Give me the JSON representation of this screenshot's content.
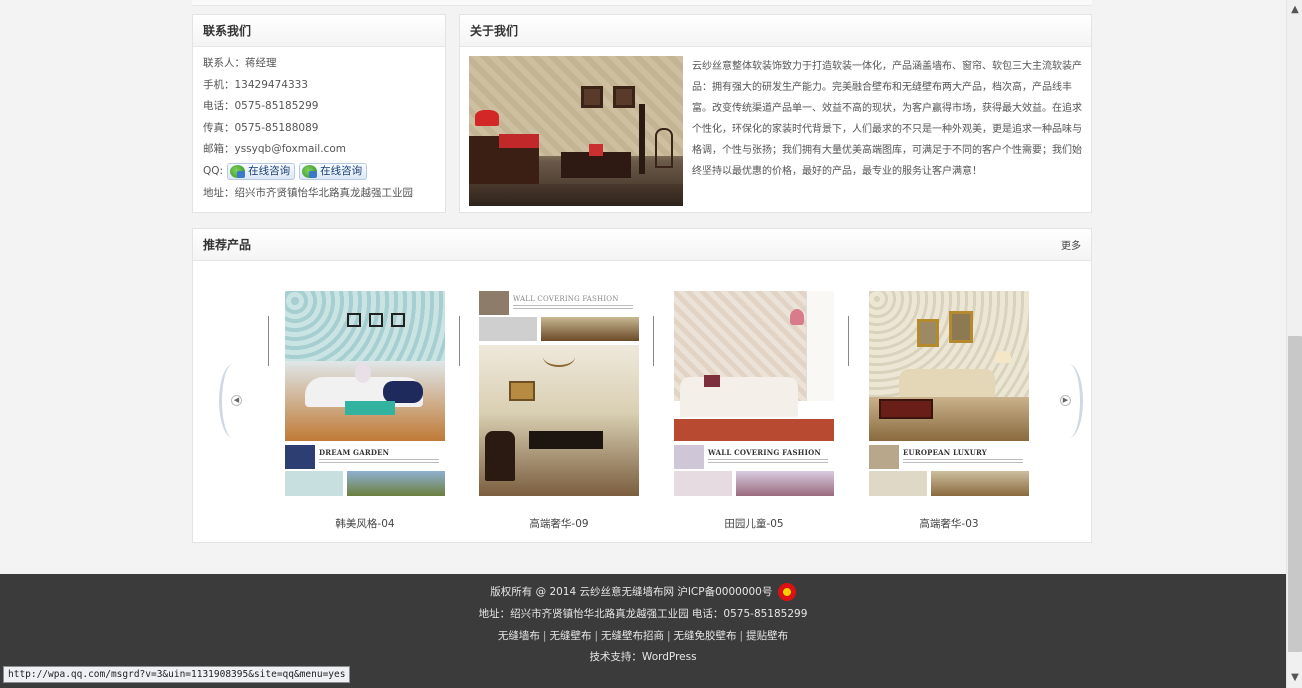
{
  "contact": {
    "title": "联系我们",
    "contact_person": "联系人：蒋经理",
    "mobile": "手机：13429474333",
    "phone": "电话：0575-85185299",
    "fax": "传真：0575-85188089",
    "email": "邮箱：yssyqb@foxmail.com",
    "qq_label": "QQ:",
    "qq_buttons": [
      "在线咨询",
      "在线咨询"
    ],
    "address": "地址：绍兴市齐贤镇怡华北路真龙越强工业园"
  },
  "about": {
    "title": "关于我们",
    "text": "云纱丝意整体软装饰致力于打造软装一体化，产品涵盖墙布、窗帘、软包三大主流软装产品：拥有强大的研发生产能力。完美融合壁布和无缝壁布两大产品，档次高，产品线丰富。改变传统渠道产品单一、效益不高的现状，为客户赢得市场，获得最大效益。在追求个性化，环保化的家装时代背景下，人们最求的不只是一种外观美，更是追求一种品味与格调，个性与张扬；我们拥有大量优美高端图库，可满足于不同的客户个性需要；我们始终坚持以最优惠的价格，最好的产品，最专业的服务让客户满意！"
  },
  "recommend": {
    "title": "推荐产品",
    "more": "更多",
    "products": [
      {
        "name": "韩美风格-04",
        "caption": "DREAM GARDEN"
      },
      {
        "name": "高端奢华-09",
        "caption": "WALL COVERING FASHION"
      },
      {
        "name": "田园儿童-05",
        "caption": "WALL COVERING FASHION"
      },
      {
        "name": "高端奢华-03",
        "caption": "EUROPEAN LUXURY"
      }
    ]
  },
  "footer": {
    "copyright": "版权所有 @ 2014 云纱丝意无缝墙布网 沪ICP备0000000号",
    "address": "地址：绍兴市齐贤镇怡华北路真龙越强工业园 电话：0575-85185299",
    "links": [
      "无缝墙布",
      "无缝壁布",
      "无缝壁布招商",
      "无缝免胶壁布",
      "提贴壁布"
    ],
    "support": "技术支持：WordPress"
  },
  "statusbar": {
    "url": "http://wpa.qq.com/msgrd?v=3&uin=1131908395&site=qq&menu=yes"
  }
}
